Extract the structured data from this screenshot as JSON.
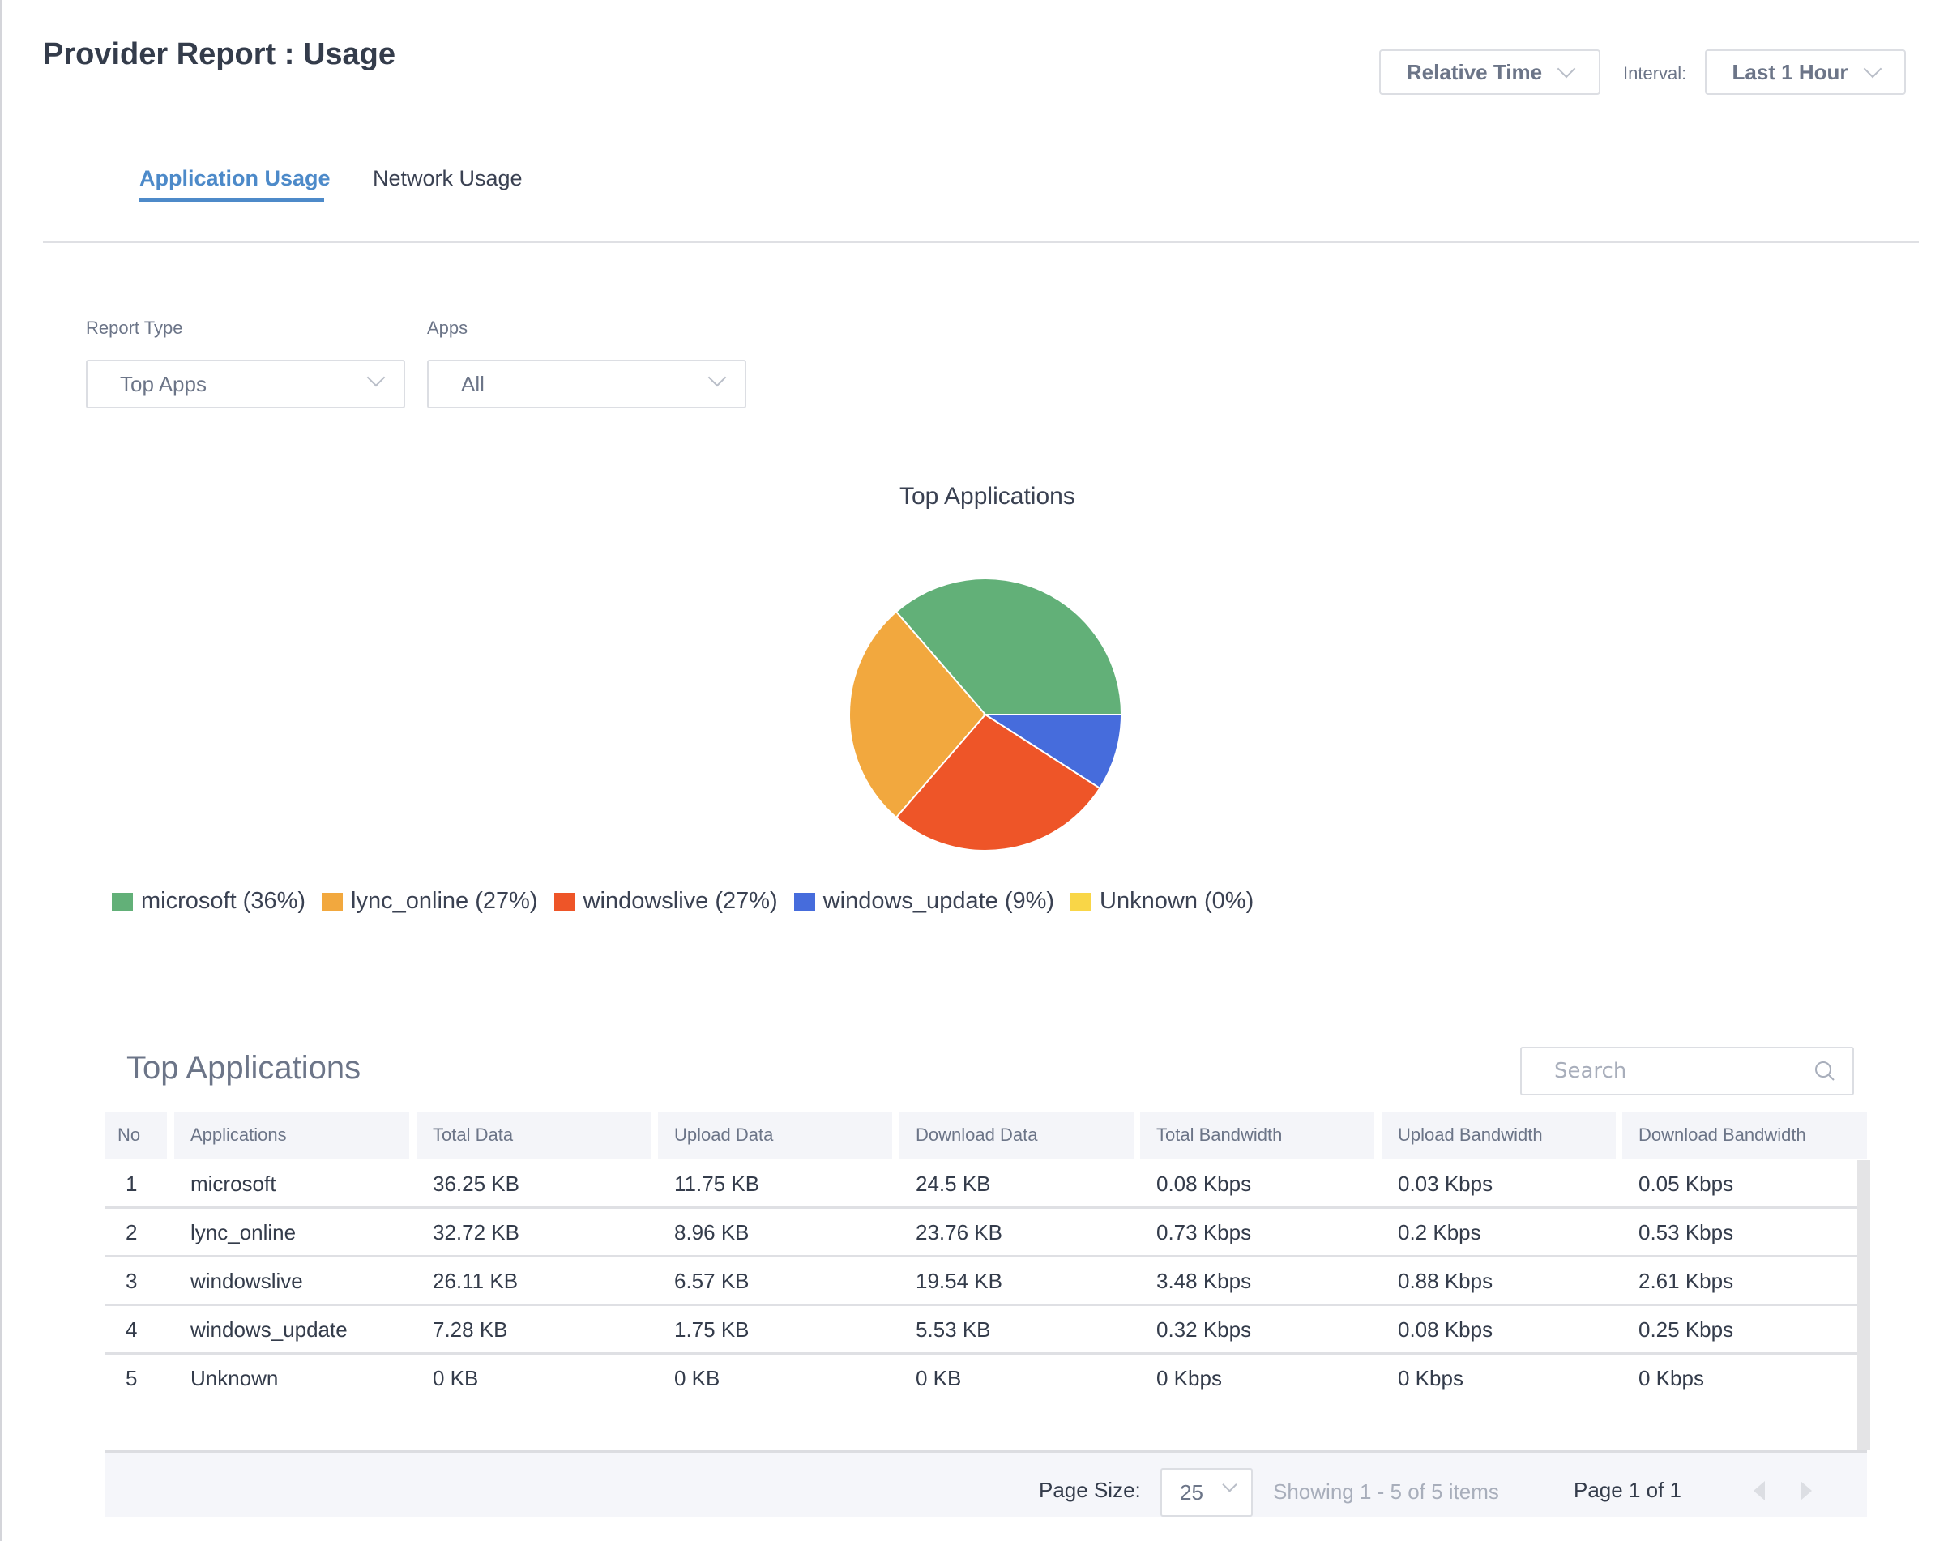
{
  "page": {
    "title": "Provider Report : Usage",
    "time_mode": "Relative Time",
    "interval_label": "Interval:",
    "interval_value": "Last 1 Hour"
  },
  "tabs": [
    {
      "label": "Application Usage",
      "active": true
    },
    {
      "label": "Network Usage",
      "active": false
    }
  ],
  "filters": {
    "report_type_label": "Report Type",
    "report_type_value": "Top Apps",
    "apps_label": "Apps",
    "apps_value": "All"
  },
  "chart_data": {
    "type": "pie",
    "title": "Top Applications",
    "categories": [
      "microsoft",
      "lync_online",
      "windowslive",
      "windows_update",
      "Unknown"
    ],
    "values": [
      36,
      27,
      27,
      9,
      0
    ],
    "unit": "%",
    "colors": [
      "#62b078",
      "#f2a83e",
      "#ee5528",
      "#466cdc",
      "#f9d647"
    ],
    "legend_labels": [
      "microsoft (36%)",
      "lync_online (27%)",
      "windowslive (27%)",
      "windows_update (9%)",
      "Unknown (0%)"
    ],
    "legend_position": "bottom",
    "start_angle": "3 o'clock",
    "direction": "counterclockwise"
  },
  "table": {
    "title": "Top Applications",
    "search_placeholder": "Search",
    "columns": [
      "No",
      "Applications",
      "Total Data",
      "Upload Data",
      "Download Data",
      "Total Bandwidth",
      "Upload Bandwidth",
      "Download Bandwidth"
    ],
    "rows": [
      [
        "1",
        "microsoft",
        "36.25 KB",
        "11.75 KB",
        "24.5 KB",
        "0.08 Kbps",
        "0.03 Kbps",
        "0.05 Kbps"
      ],
      [
        "2",
        "lync_online",
        "32.72 KB",
        "8.96 KB",
        "23.76 KB",
        "0.73 Kbps",
        "0.2 Kbps",
        "0.53 Kbps"
      ],
      [
        "3",
        "windowslive",
        "26.11 KB",
        "6.57 KB",
        "19.54 KB",
        "3.48 Kbps",
        "0.88 Kbps",
        "2.61 Kbps"
      ],
      [
        "4",
        "windows_update",
        "7.28 KB",
        "1.75 KB",
        "5.53 KB",
        "0.32 Kbps",
        "0.08 Kbps",
        "0.25 Kbps"
      ],
      [
        "5",
        "Unknown",
        "0 KB",
        "0 KB",
        "0 KB",
        "0 Kbps",
        "0 Kbps",
        "0 Kbps"
      ]
    ]
  },
  "pager": {
    "page_size_label": "Page Size:",
    "page_size_value": "25",
    "showing": "Showing 1 - 5 of 5 items",
    "page_info": "Page 1 of 1"
  }
}
